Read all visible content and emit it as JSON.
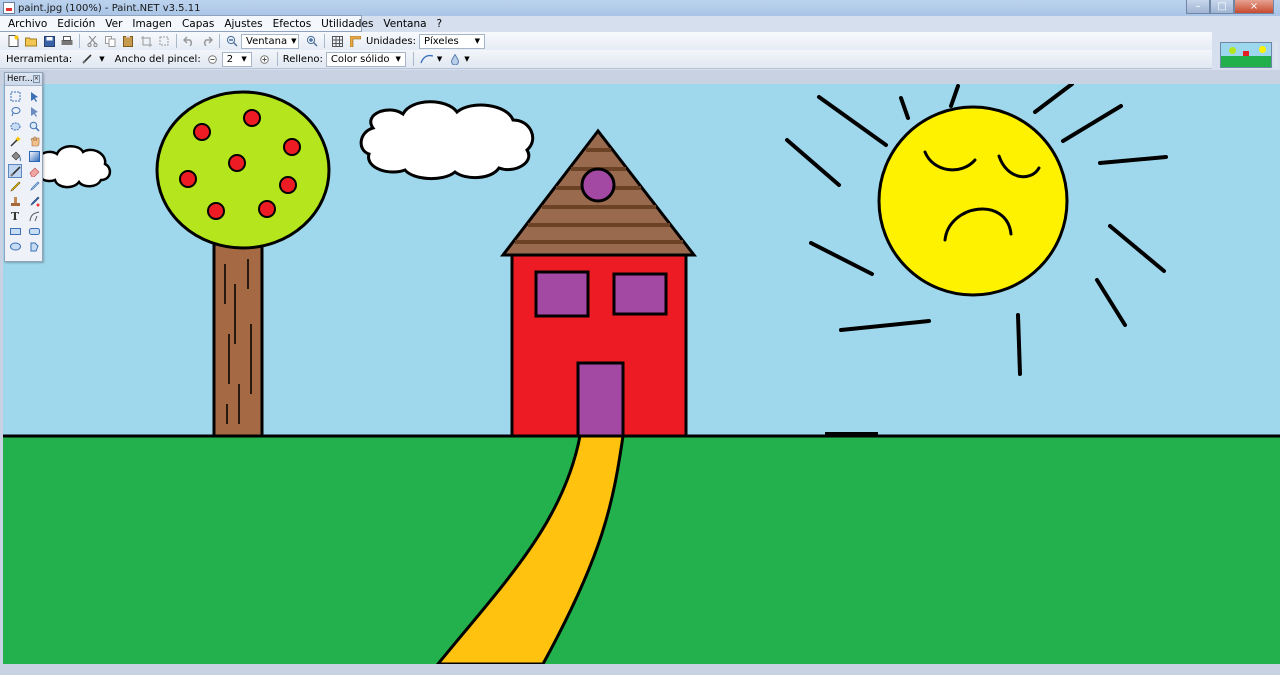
{
  "window": {
    "title": "paint.jpg (100%) - Paint.NET v3.5.11",
    "buttons": [
      "–",
      "□",
      "×"
    ]
  },
  "menu": {
    "items": [
      "Archivo",
      "Edición",
      "Ver",
      "Imagen",
      "Capas",
      "Ajustes",
      "Efectos",
      "Utilidades",
      "Ventana",
      "?"
    ]
  },
  "toolbar": {
    "zoom_value": "Ventana",
    "units_label": "Unidades:",
    "units_value": "Píxeles"
  },
  "options_bar": {
    "tool_label": "Herramienta:",
    "brush_width_label": "Ancho del pincel:",
    "brush_width_value": "2",
    "fill_label": "Relleno:",
    "fill_value": "Color sólido"
  },
  "tools_window": {
    "title": "Herr...",
    "tools": [
      "rectangle-select",
      "move-selection",
      "lasso-select",
      "move-selected",
      "ellipse-select",
      "zoom",
      "magic-wand",
      "pan",
      "paint-bucket",
      "gradient",
      "paintbrush",
      "eraser",
      "pencil",
      "color-picker",
      "clone-stamp",
      "recolor",
      "text",
      "line-curve",
      "rectangle",
      "rounded-rectangle",
      "ellipse",
      "freeform-shape"
    ],
    "active_tool": "paintbrush"
  },
  "drawing": {
    "sky_color": "#9fd8ec",
    "grass_color": "#22b14c",
    "house_color": "#ed1c24",
    "roof_color": "#9a6a4f",
    "window_color": "#a349a4",
    "path_color": "#ffc20e",
    "sun_color": "#fff200",
    "tree_top_color": "#b5e61d",
    "trunk_color": "#a56a43",
    "apple_color": "#ed1c24"
  }
}
